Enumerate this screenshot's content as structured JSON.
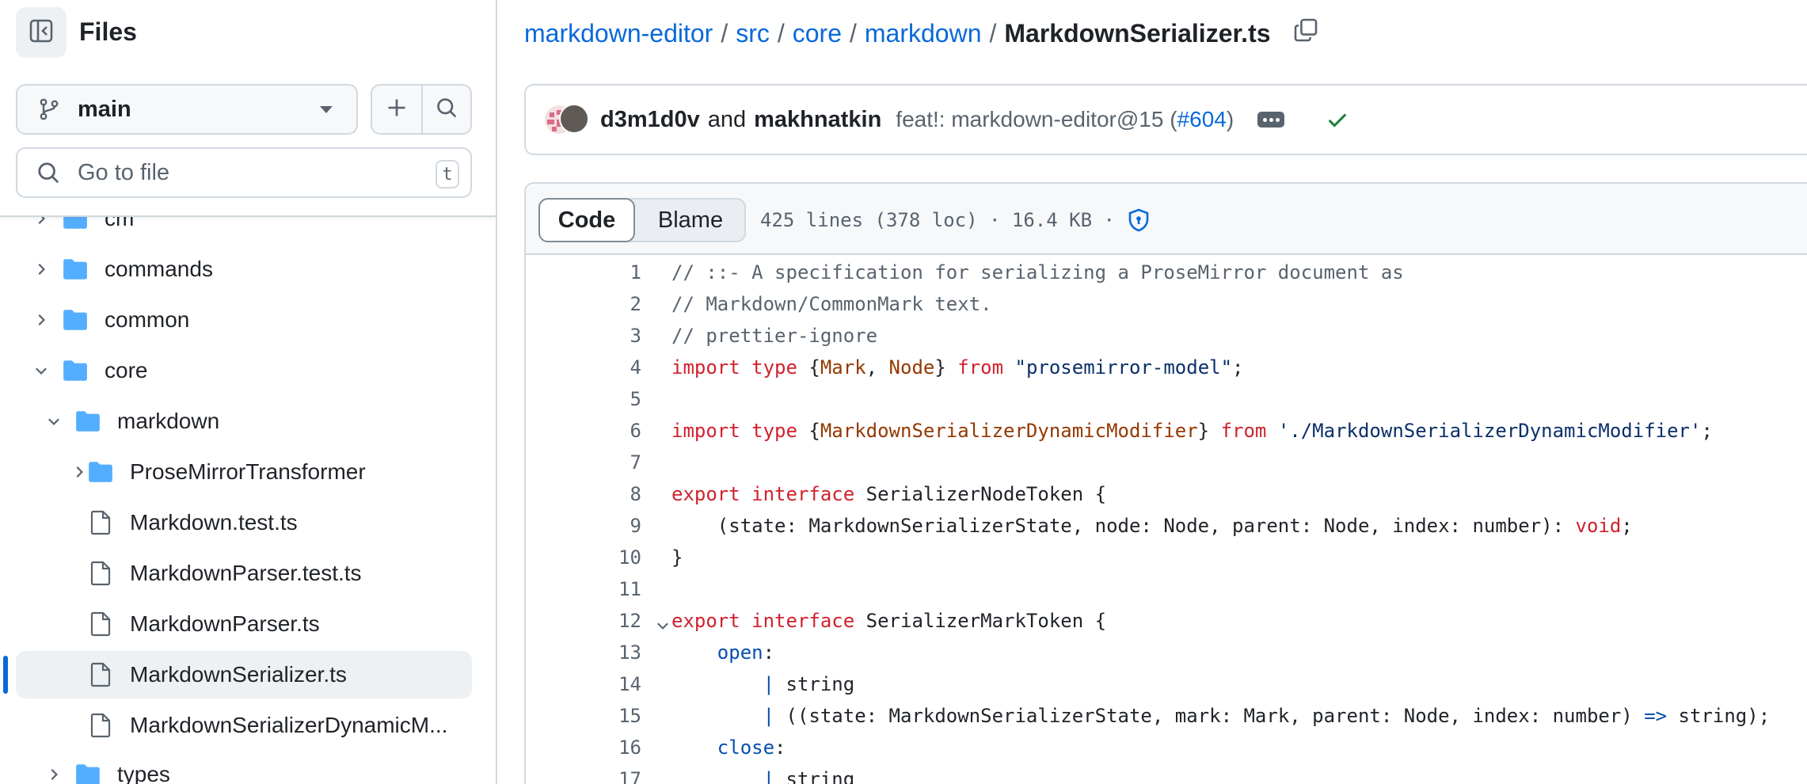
{
  "sidebar": {
    "title": "Files",
    "branch": "main",
    "goto_placeholder": "Go to file",
    "goto_shortcut": "t",
    "tree": [
      {
        "label": "cm",
        "type": "folder",
        "expanded": false,
        "depth": 0
      },
      {
        "label": "commands",
        "type": "folder",
        "expanded": false,
        "depth": 0
      },
      {
        "label": "common",
        "type": "folder",
        "expanded": false,
        "depth": 0
      },
      {
        "label": "core",
        "type": "folder",
        "expanded": true,
        "depth": 0
      },
      {
        "label": "markdown",
        "type": "folder",
        "expanded": true,
        "depth": 1
      },
      {
        "label": "ProseMirrorTransformer",
        "type": "folder",
        "expanded": false,
        "depth": 2
      },
      {
        "label": "Markdown.test.ts",
        "type": "file",
        "depth": 2
      },
      {
        "label": "MarkdownParser.test.ts",
        "type": "file",
        "depth": 2
      },
      {
        "label": "MarkdownParser.ts",
        "type": "file",
        "depth": 2
      },
      {
        "label": "MarkdownSerializer.ts",
        "type": "file",
        "depth": 2,
        "active": true
      },
      {
        "label": "MarkdownSerializerDynamicM...",
        "type": "file",
        "depth": 2
      },
      {
        "label": "types",
        "type": "folder",
        "expanded": false,
        "depth": 1
      }
    ]
  },
  "breadcrumb": {
    "repo": "markdown-editor",
    "parts": [
      "src",
      "core",
      "markdown"
    ],
    "current": "MarkdownSerializer.ts",
    "separator": "/"
  },
  "commit": {
    "author1": "d3m1d0v",
    "and": "and",
    "author2": "makhnatkin",
    "message_prefix": "feat!: markdown-editor@15 (",
    "pr": "#604",
    "message_suffix": ")",
    "status": "success",
    "status_color": "#1a7f37"
  },
  "file": {
    "tabs": [
      "Code",
      "Blame"
    ],
    "active_tab": "Code",
    "meta": "425 lines (378 loc) · 16.4 KB ·"
  },
  "code_lines": [
    {
      "n": "1",
      "segs": [
        {
          "t": "// ::- A specification for serializing a ProseMirror document as",
          "c": "com"
        }
      ]
    },
    {
      "n": "2",
      "segs": [
        {
          "t": "// Markdown/CommonMark text.",
          "c": "com"
        }
      ]
    },
    {
      "n": "3",
      "segs": [
        {
          "t": "// prettier-ignore",
          "c": "com"
        }
      ]
    },
    {
      "n": "4",
      "segs": [
        {
          "t": "import type ",
          "c": "kw"
        },
        {
          "t": "{",
          "c": ""
        },
        {
          "t": "Mark",
          "c": "ty"
        },
        {
          "t": ", ",
          "c": ""
        },
        {
          "t": "Node",
          "c": "ty"
        },
        {
          "t": "} ",
          "c": ""
        },
        {
          "t": "from ",
          "c": "kw"
        },
        {
          "t": "\"prosemirror-model\"",
          "c": "str"
        },
        {
          "t": ";",
          "c": ""
        }
      ]
    },
    {
      "n": "5",
      "segs": []
    },
    {
      "n": "6",
      "segs": [
        {
          "t": "import type ",
          "c": "kw"
        },
        {
          "t": "{",
          "c": ""
        },
        {
          "t": "MarkdownSerializerDynamicModifier",
          "c": "ty"
        },
        {
          "t": "} ",
          "c": ""
        },
        {
          "t": "from ",
          "c": "kw"
        },
        {
          "t": "'./MarkdownSerializerDynamicModifier'",
          "c": "str"
        },
        {
          "t": ";",
          "c": ""
        }
      ]
    },
    {
      "n": "7",
      "segs": []
    },
    {
      "n": "8",
      "segs": [
        {
          "t": "export interface ",
          "c": "kw"
        },
        {
          "t": "SerializerNodeToken {",
          "c": ""
        }
      ]
    },
    {
      "n": "9",
      "segs": [
        {
          "t": "    (state: MarkdownSerializerState, node: Node, parent: Node, index: number): ",
          "c": ""
        },
        {
          "t": "void",
          "c": "kw"
        },
        {
          "t": ";",
          "c": ""
        }
      ]
    },
    {
      "n": "10",
      "segs": [
        {
          "t": "}",
          "c": ""
        }
      ]
    },
    {
      "n": "11",
      "segs": []
    },
    {
      "n": "12",
      "fold": true,
      "segs": [
        {
          "t": "export interface ",
          "c": "kw"
        },
        {
          "t": "SerializerMarkToken {",
          "c": ""
        }
      ]
    },
    {
      "n": "13",
      "segs": [
        {
          "t": "    ",
          "c": ""
        },
        {
          "t": "open",
          "c": "prop"
        },
        {
          "t": ":",
          "c": ""
        }
      ]
    },
    {
      "n": "14",
      "segs": [
        {
          "t": "        ",
          "c": ""
        },
        {
          "t": "|",
          "c": "prop"
        },
        {
          "t": " string",
          "c": ""
        }
      ]
    },
    {
      "n": "15",
      "segs": [
        {
          "t": "        ",
          "c": ""
        },
        {
          "t": "|",
          "c": "prop"
        },
        {
          "t": " ((state: MarkdownSerializerState, mark: Mark, parent: Node, index: number) ",
          "c": ""
        },
        {
          "t": "=>",
          "c": "prop"
        },
        {
          "t": " string);",
          "c": ""
        }
      ]
    },
    {
      "n": "16",
      "segs": [
        {
          "t": "    ",
          "c": ""
        },
        {
          "t": "close",
          "c": "prop"
        },
        {
          "t": ":",
          "c": ""
        }
      ]
    },
    {
      "n": "17",
      "segs": [
        {
          "t": "        ",
          "c": ""
        },
        {
          "t": "|",
          "c": "prop"
        },
        {
          "t": " string",
          "c": ""
        }
      ]
    }
  ]
}
